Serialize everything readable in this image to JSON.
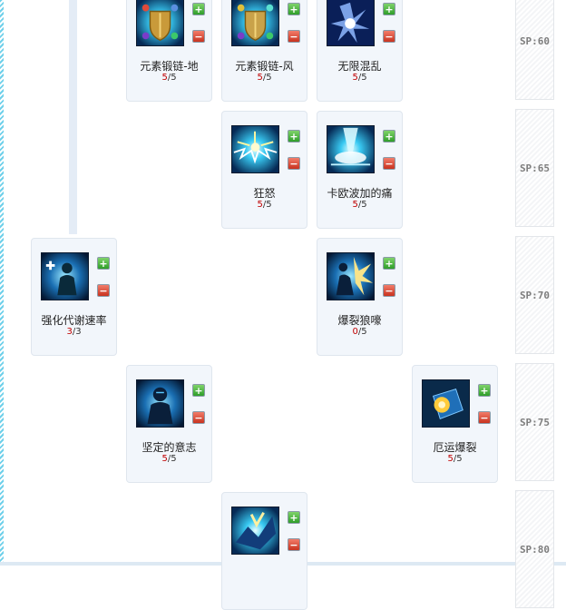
{
  "skills": [
    {
      "name": "元素锻链-地",
      "current": "5",
      "max": "5",
      "icon": "earth-shield-icon"
    },
    {
      "name": "元素锻链-风",
      "current": "5",
      "max": "5",
      "icon": "wind-shield-icon"
    },
    {
      "name": "无限混乱",
      "current": "5",
      "max": "5",
      "icon": "infinite-chaos-icon"
    },
    {
      "name": "狂怒",
      "current": "5",
      "max": "5",
      "icon": "fury-icon"
    },
    {
      "name": "卡欧波加的痛",
      "current": "5",
      "max": "5",
      "icon": "pain-burst-icon"
    },
    {
      "name": "强化代谢速率",
      "current": "3",
      "max": "3",
      "icon": "metabolism-icon"
    },
    {
      "name": "爆裂狼嚎",
      "current": "0",
      "max": "5",
      "icon": "explosive-howl-icon"
    },
    {
      "name": "坚定的意志",
      "current": "5",
      "max": "5",
      "icon": "firm-will-icon"
    },
    {
      "name": "厄运爆裂",
      "current": "5",
      "max": "5",
      "icon": "doom-burst-icon"
    },
    {
      "name": "",
      "current": "",
      "max": "",
      "icon": "crystal-strike-icon"
    }
  ],
  "sp_labels": [
    "SP:60",
    "SP:65",
    "SP:70",
    "SP:75",
    "SP:80"
  ],
  "buttons": {
    "plus": "+",
    "minus": "−",
    "separator": "/"
  },
  "colors": {
    "accent": "#2f9e2a",
    "level_current": "#c00000",
    "card_bg": "#f2f6fb"
  }
}
